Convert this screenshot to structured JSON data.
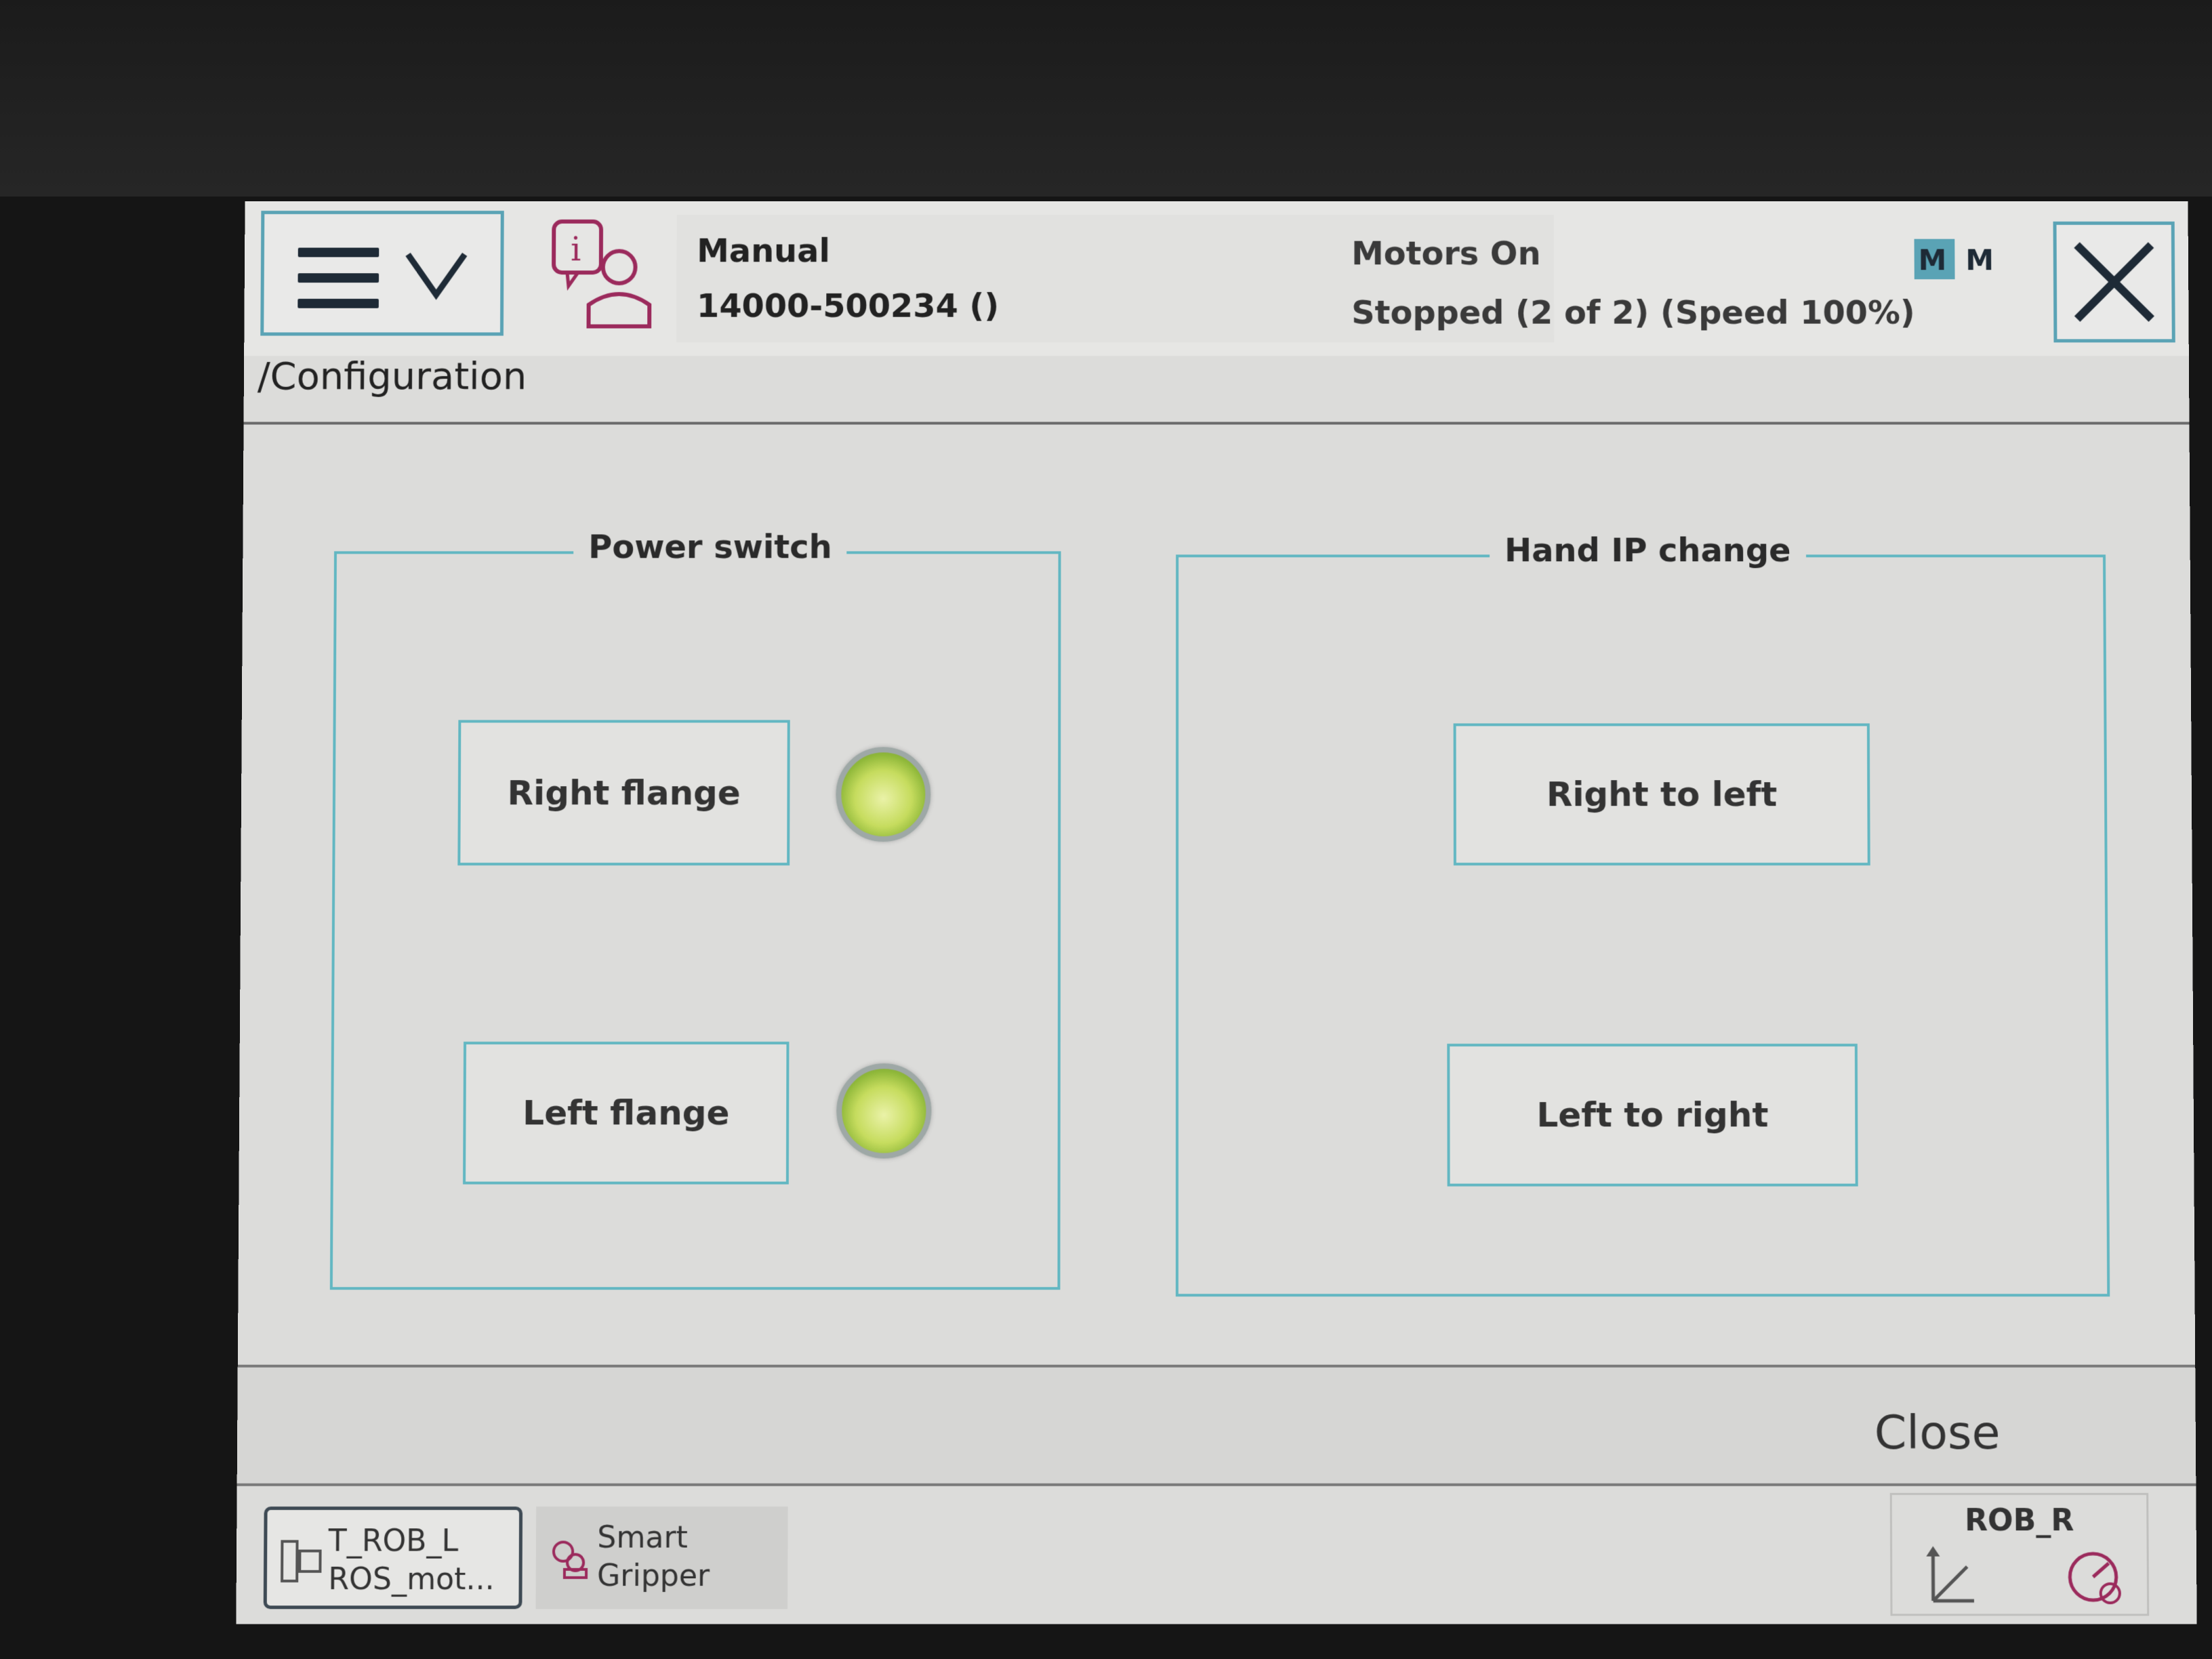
{
  "header": {
    "operating_mode": "Manual",
    "controller_id": "14000-500234 ()",
    "motors_status": "Motors On",
    "run_status": "Stopped (2 of 2) (Speed 100%)"
  },
  "breadcrumb": "/Configuration",
  "power_switch": {
    "title": "Power switch",
    "right_flange_label": "Right flange",
    "left_flange_label": "Left flange"
  },
  "hand_ip_change": {
    "title": "Hand IP change",
    "right_to_left_label": "Right to left",
    "left_to_right_label": "Left to right"
  },
  "command_bar": {
    "close_label": "Close"
  },
  "taskbar": {
    "task1_line1": "T_ROB_L",
    "task1_line2": "ROS_mot...",
    "task2_line1": "Smart",
    "task2_line2": "Gripper",
    "mechunit_label": "ROB_R"
  },
  "colors": {
    "accent_border": "#62b7c2",
    "led_on": "#c6dc5e"
  }
}
